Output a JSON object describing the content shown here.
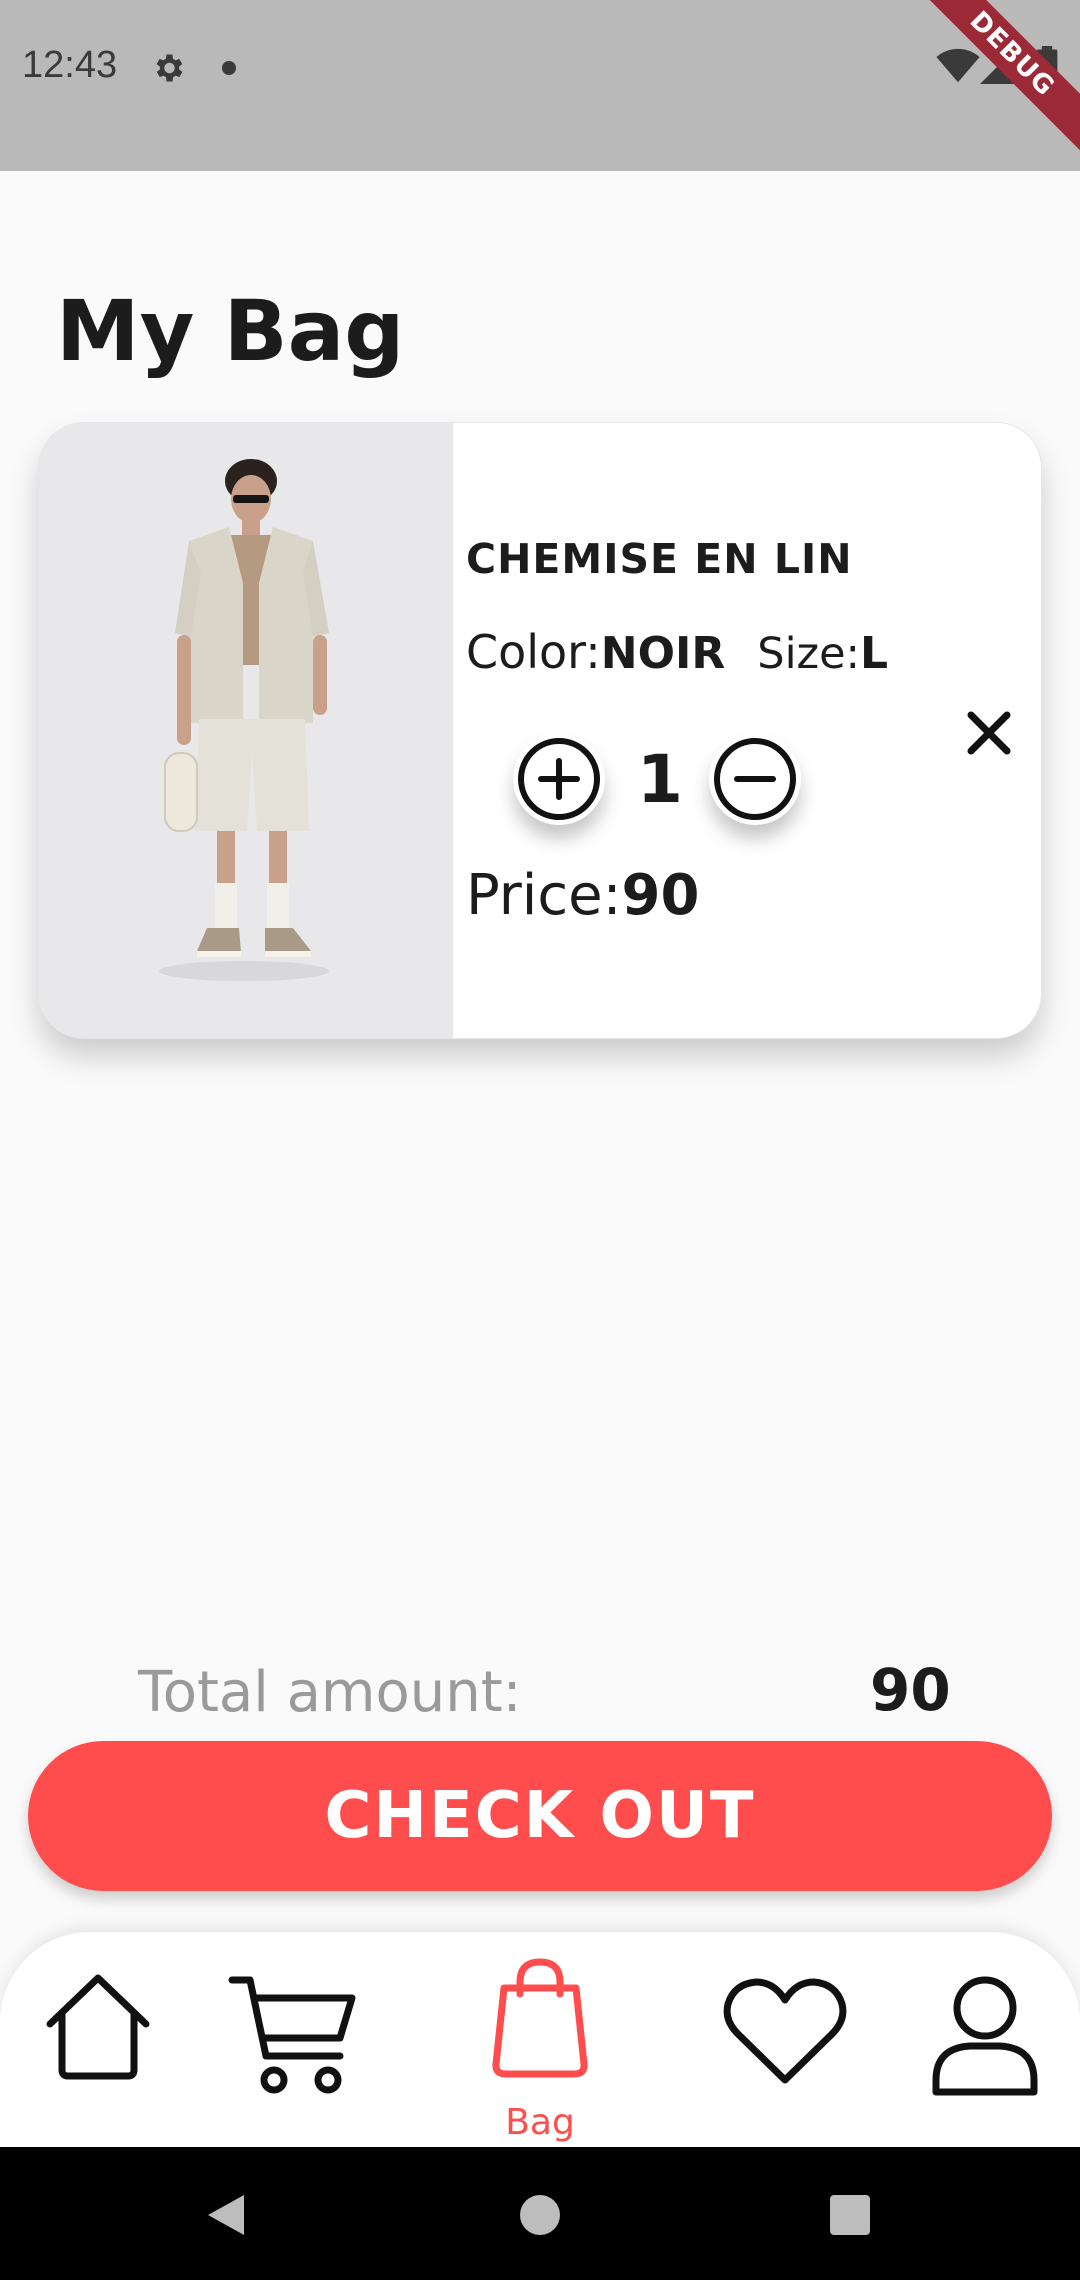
{
  "status_bar": {
    "time": "12:43",
    "icons": [
      "gear-icon",
      "dot-icon",
      "wifi-icon",
      "signal-icon",
      "battery-icon"
    ],
    "debug_banner": "DEBUG"
  },
  "page": {
    "title": "My Bag"
  },
  "bag_items": [
    {
      "image": "product-photo-man-linen-shirt-shorts",
      "name": "CHEMISE EN LIN",
      "color_label": "Color:",
      "color_value": "NOIR",
      "size_label": "Size:",
      "size_value": "L",
      "quantity": "1",
      "price_label": "Price:",
      "price_value": "90"
    }
  ],
  "summary": {
    "total_label": "Total amount:",
    "total_value": "90",
    "checkout_label": "CHECK OUT"
  },
  "bottom_nav": {
    "items": [
      {
        "icon": "home-icon",
        "label": ""
      },
      {
        "icon": "cart-icon",
        "label": ""
      },
      {
        "icon": "bag-icon",
        "label": "Bag"
      },
      {
        "icon": "heart-icon",
        "label": ""
      },
      {
        "icon": "profile-icon",
        "label": ""
      }
    ],
    "active_index": 2
  },
  "colors": {
    "accent": "#ff4d4d",
    "status_bar": "#b9b9b9",
    "debug_ribbon": "#9b2a36",
    "text": "#1c1c1c",
    "muted_text": "#9a9a9a"
  }
}
